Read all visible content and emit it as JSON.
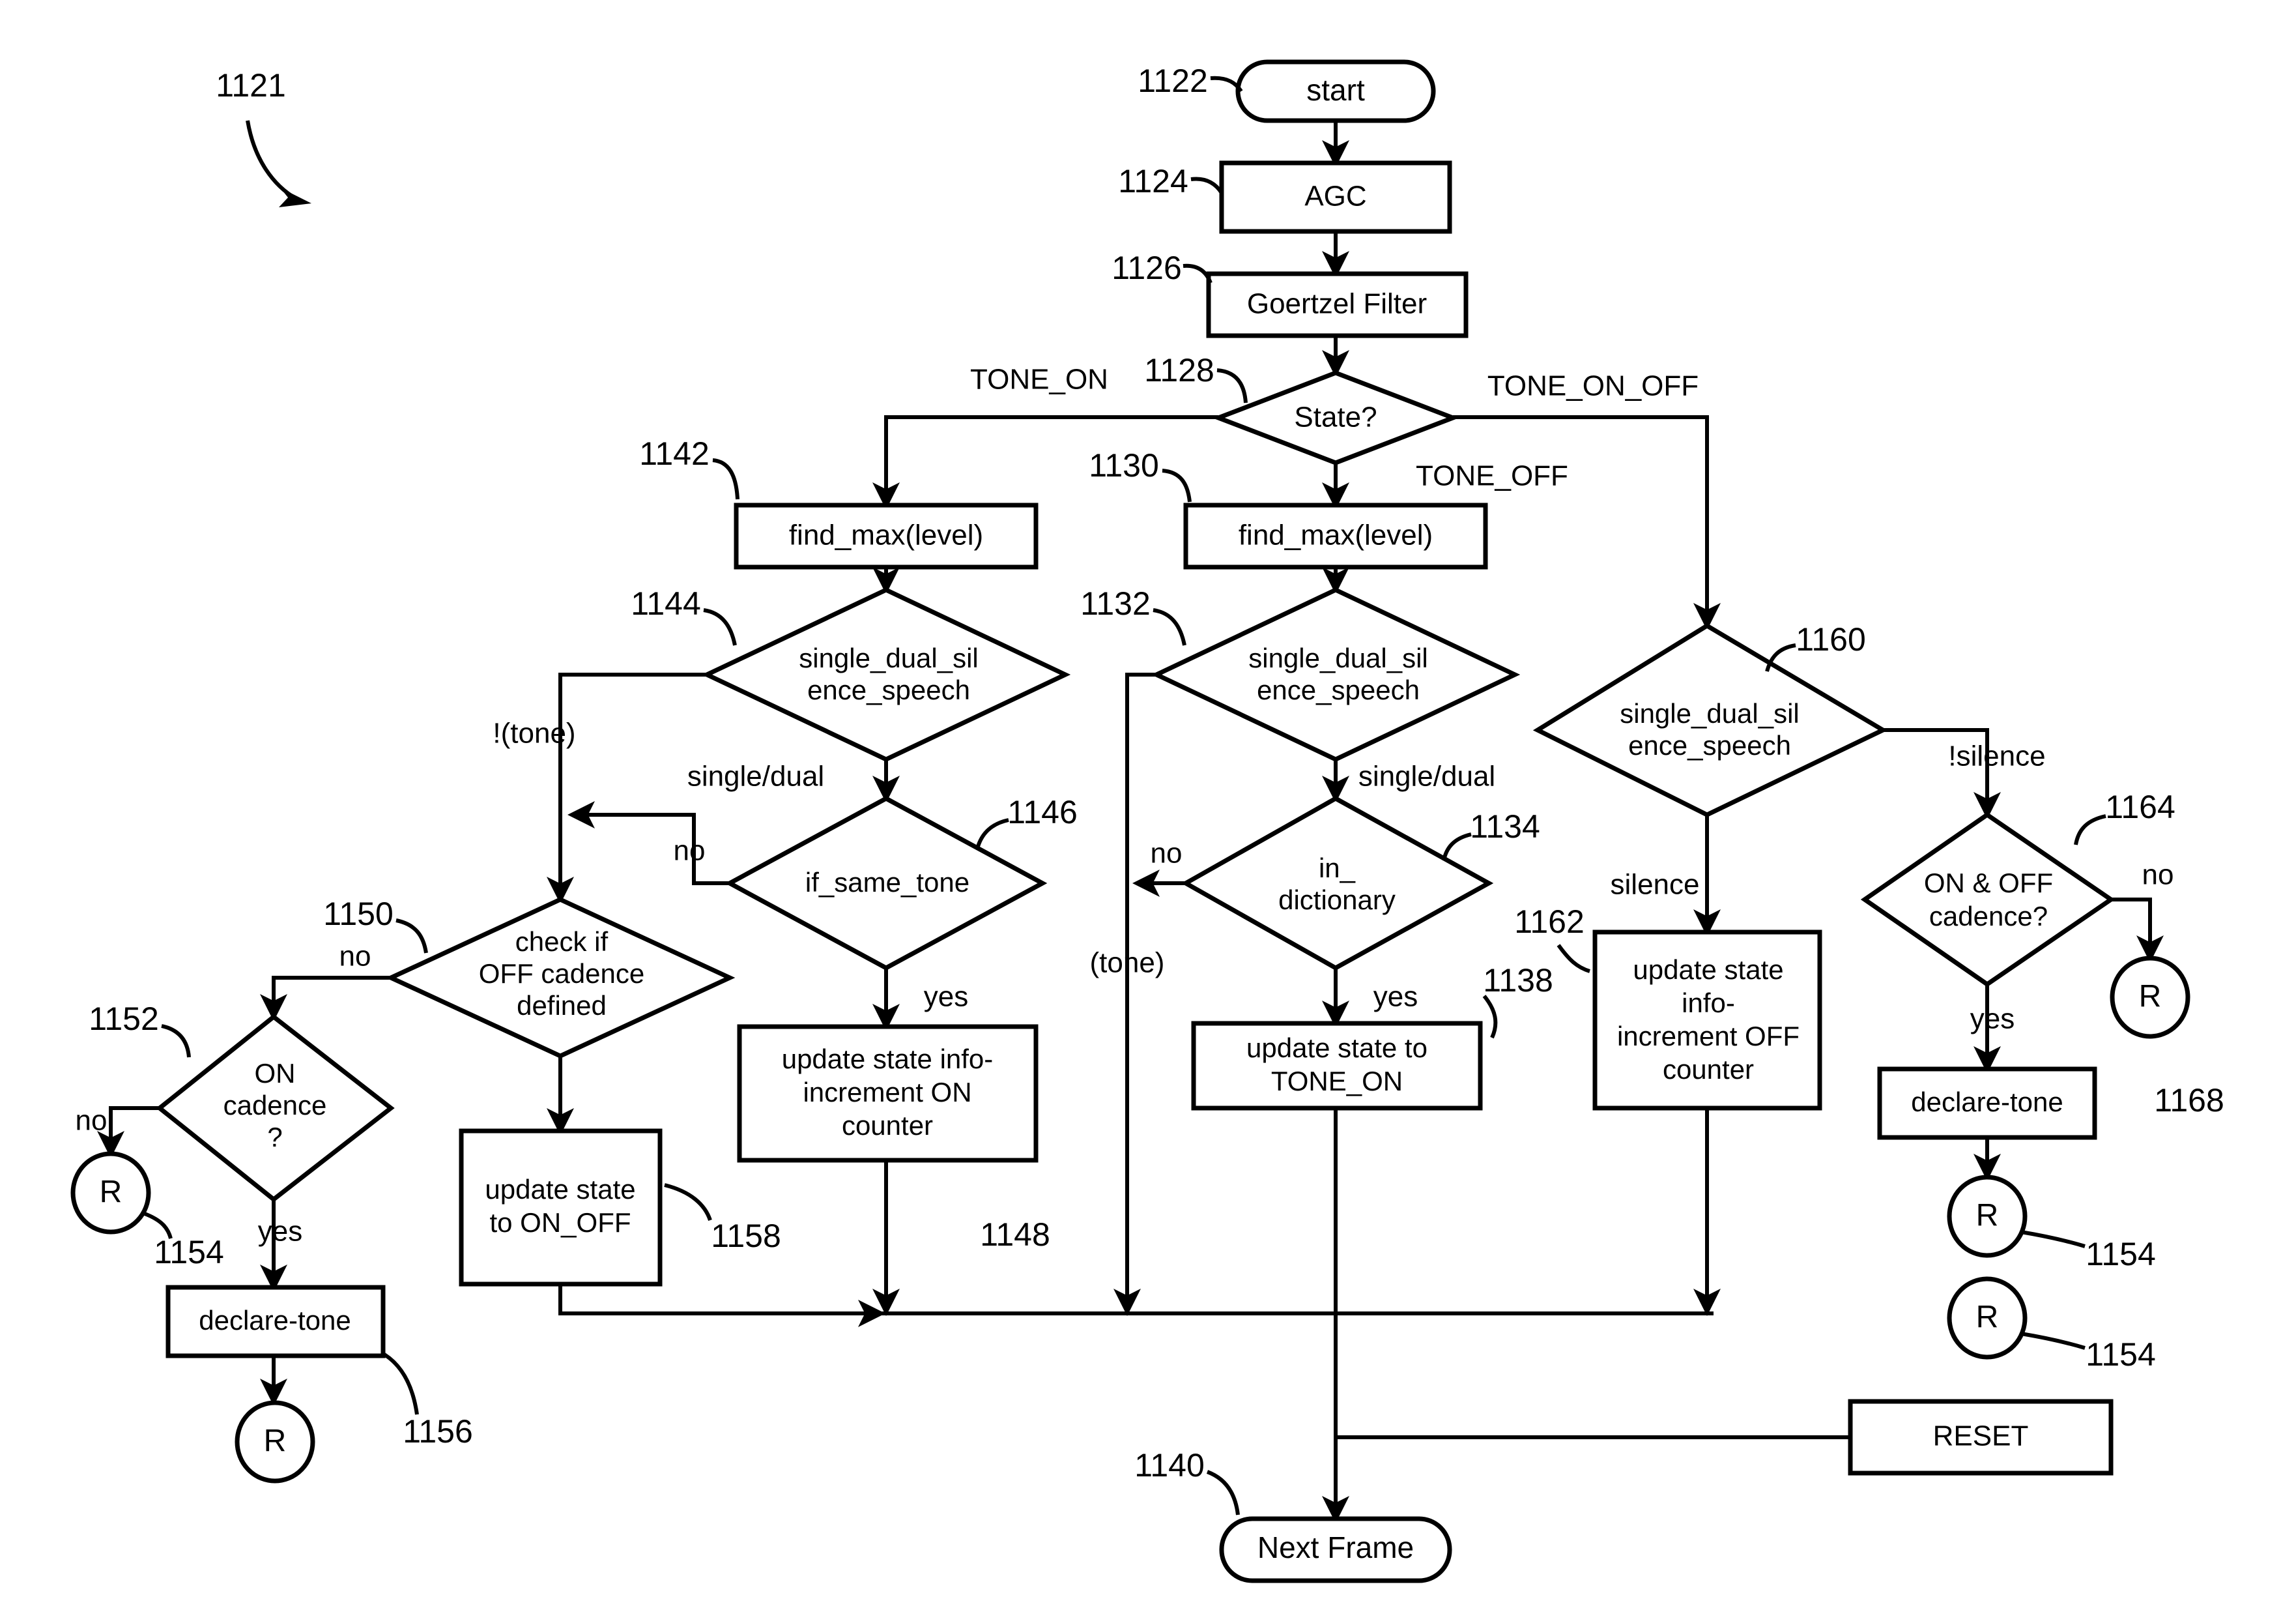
{
  "figure": {
    "ref": "1121"
  },
  "nodes": {
    "start": {
      "id": "1122",
      "label": "start"
    },
    "agc": {
      "id": "1124",
      "label": "AGC"
    },
    "goertzel": {
      "id": "1126",
      "label": "Goertzel Filter"
    },
    "state": {
      "id": "1128",
      "label": "State?"
    },
    "find_max_left": {
      "id": "1142",
      "label": "find_max(level)"
    },
    "find_max_mid": {
      "id": "1130",
      "label": "find_max(level)"
    },
    "sds_left": {
      "id": "1144",
      "line1": "single_dual_sil",
      "line2": "ence_speech"
    },
    "sds_mid": {
      "id": "1132",
      "line1": "single_dual_sil",
      "line2": "ence_speech"
    },
    "sds_right": {
      "id": "1160",
      "line1": "single_dual_sil",
      "line2": "ence_speech"
    },
    "if_same_tone": {
      "id": "1146",
      "label": "if_same_tone"
    },
    "in_dictionary": {
      "id": "1134",
      "line1": "in_",
      "line2": "dictionary"
    },
    "check_off_cad": {
      "id": "1150",
      "line1": "check if",
      "line2": "OFF cadence",
      "line3": "defined"
    },
    "on_cadence": {
      "id": "1152",
      "line1": "ON",
      "line2": "cadence",
      "line3": "?"
    },
    "on_off_cadence": {
      "id": "1164",
      "line1": "ON & OFF",
      "line2": "cadence?"
    },
    "upd_on_counter": {
      "id": "1148",
      "line1": "update state info-",
      "line2": "increment ON",
      "line3": "counter"
    },
    "upd_state_on_off": {
      "id": "1158",
      "line1": "update state",
      "line2": "to ON_OFF"
    },
    "upd_state_tone_on": {
      "id": "1138",
      "line1": "update state to",
      "line2": "TONE_ON"
    },
    "upd_off_counter": {
      "id": "1162",
      "line1": "update state",
      "line2": "info-",
      "line3": "increment OFF",
      "line4": "counter"
    },
    "declare_tone_left": {
      "id": "1156",
      "label": "declare-tone"
    },
    "declare_tone_right": {
      "id": "1168",
      "label": "declare-tone"
    },
    "reset": {
      "id": "",
      "label": "RESET"
    },
    "next_frame": {
      "id": "1140",
      "label": "Next Frame"
    },
    "r_left_on_cad": {
      "id": "1154",
      "label": "R"
    },
    "r_left_declare": {
      "id": "1156",
      "label": "R"
    },
    "r_right_no": {
      "id": "",
      "label": "R"
    },
    "r_right_declare": {
      "id": "1154",
      "label": "R"
    },
    "r_right_reset": {
      "id": "1154",
      "label": "R"
    }
  },
  "edge_labels": {
    "tone_on": "TONE_ON",
    "tone_on_off": "TONE_ON_OFF",
    "tone_off": "TONE_OFF",
    "not_tone": "!(tone)",
    "single_dual_left": "single/dual",
    "single_dual_mid": "single/dual",
    "no_if_same_tone": "no",
    "yes_if_same_tone": "yes",
    "no_in_dictionary": "no",
    "yes_in_dictionary": "yes",
    "tone_paren": "(tone)",
    "no_check_off": "no",
    "no_on_cadence": "no",
    "yes_on_cadence": "yes",
    "not_silence": "!silence",
    "silence": "silence",
    "no_on_off_cadence": "no",
    "yes_on_off_cadence": "yes"
  },
  "ref_numbers": {
    "fig": "1121",
    "start": "1122",
    "agc": "1124",
    "goertzel": "1126",
    "state": "1128",
    "find_max_mid": "1130",
    "sds_mid": "1132",
    "in_dictionary": "1134",
    "upd_state_tone_on": "1138",
    "next_frame": "1140",
    "find_max_left": "1142",
    "sds_left": "1144",
    "if_same_tone": "1146",
    "upd_on_counter": "1148",
    "check_off_cad": "1150",
    "on_cadence": "1152",
    "r_left_on_cad": "1154",
    "declare_tone_left": "1156",
    "upd_state_on_off": "1158",
    "sds_right": "1160",
    "upd_off_counter": "1162",
    "on_off_cadence": "1164",
    "declare_tone_right": "1168",
    "r_right_declare": "1154",
    "r_right_reset": "1154"
  },
  "colors": {
    "stroke": "#000000",
    "background": "#ffffff"
  }
}
